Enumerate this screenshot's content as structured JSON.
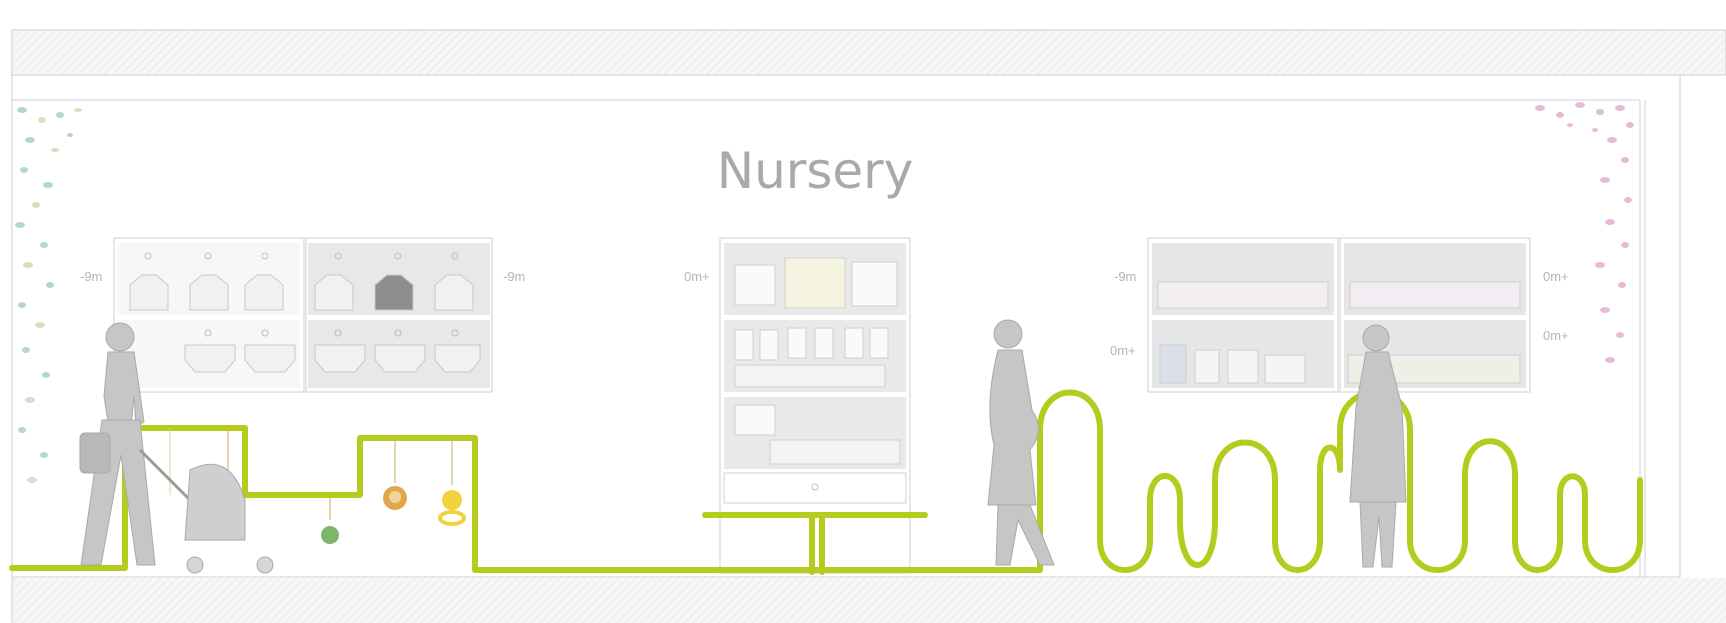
{
  "title": "Nursery",
  "labels": {
    "left_wall_unit_left": "-9m",
    "left_wall_unit_right": "-9m",
    "center_cabinet": "0m+",
    "right_wall_unit_left_top": "-9m",
    "right_wall_unit_left_bottom": "0m+",
    "right_wall_unit_right_top": "0m+",
    "right_wall_unit_right_bottom": "0m+"
  },
  "colors": {
    "accent_green": "#b5cc1e",
    "figure_gray": "#c4c4c4",
    "shelf_gray": "#e6e6e6",
    "foliage_left": "#a8cfc8",
    "foliage_right": "#e2afd2",
    "hatch": "#d9d9d9"
  },
  "icons": [
    "woman-with-stroller-silhouette",
    "pregnant-woman-silhouette",
    "standing-woman-silhouette",
    "hanging-toy-icons",
    "vine-foliage-left",
    "vine-foliage-right"
  ]
}
